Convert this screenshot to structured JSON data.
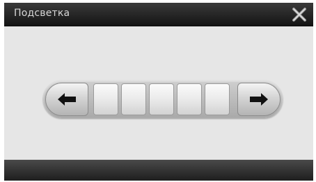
{
  "window": {
    "title": "Подсветка"
  },
  "icons": {
    "close": "close-icon",
    "left": "arrow-left-icon",
    "right": "arrow-right-icon"
  },
  "brightness": {
    "segments_total": 5,
    "segments_filled": 0
  },
  "colors": {
    "title_bar": "#1e1e1e",
    "background": "#e6e6e6",
    "bottom_bar": "#2a2a2a"
  }
}
